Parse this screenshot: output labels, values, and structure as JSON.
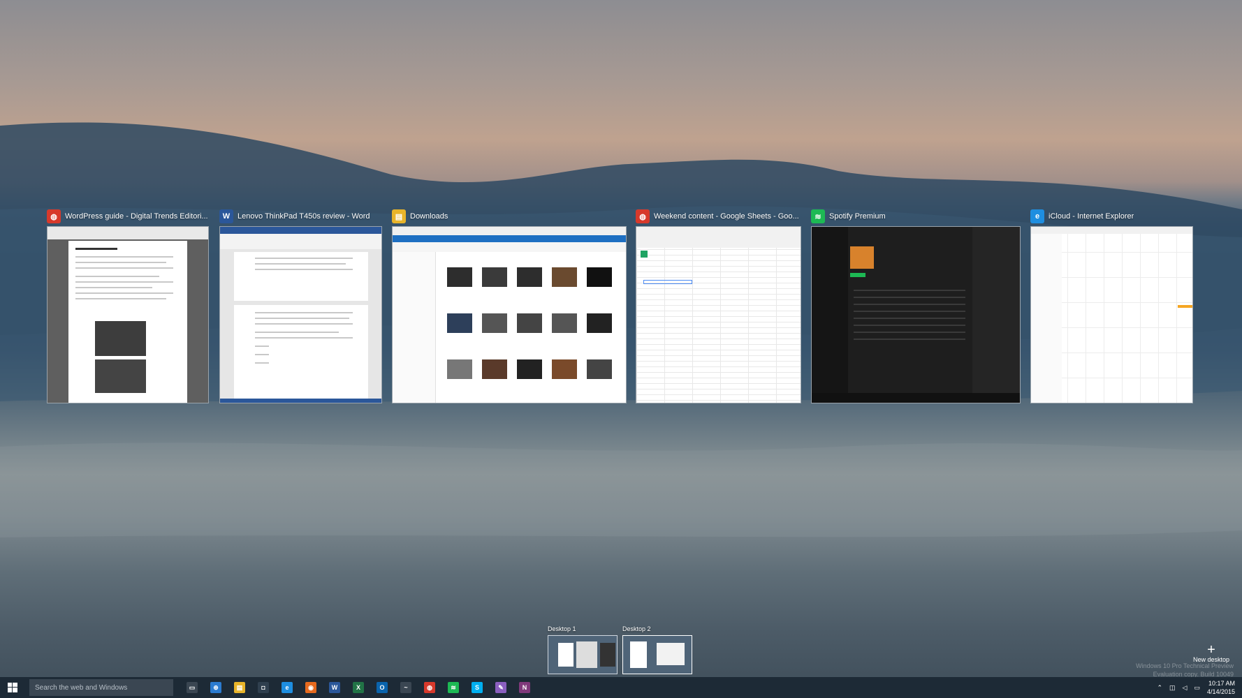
{
  "windows": [
    {
      "title": "WordPress guide - Digital Trends Editori...",
      "icon": "chrome-icon",
      "color": "#d7392b"
    },
    {
      "title": "Lenovo ThinkPad T450s review - Word",
      "icon": "word-icon",
      "color": "#2b579a"
    },
    {
      "title": "Downloads",
      "icon": "file-explorer-icon",
      "color": "#e8b42a"
    },
    {
      "title": "Weekend content - Google Sheets - Goo...",
      "icon": "chrome-icon",
      "color": "#d7392b"
    },
    {
      "title": "Spotify Premium",
      "icon": "spotify-icon",
      "color": "#1db954"
    },
    {
      "title": "iCloud - Internet Explorer",
      "icon": "internet-explorer-icon",
      "color": "#1e8ee0"
    }
  ],
  "desktops": {
    "desktop1_label": "Desktop 1",
    "desktop2_label": "Desktop 2",
    "new_desktop_label": "New desktop"
  },
  "watermark": {
    "line1": "Windows 10 Pro Technical Preview",
    "line2": "Evaluation copy. Build 10049"
  },
  "taskbar": {
    "search_placeholder": "Search the web and Windows",
    "pinned": [
      {
        "name": "task-view-icon",
        "glyph": "▭",
        "color": "#3a4652"
      },
      {
        "name": "store-icon",
        "glyph": "⊕",
        "color": "#2b7bd0"
      },
      {
        "name": "file-explorer-icon",
        "glyph": "▤",
        "color": "#e8b42a"
      },
      {
        "name": "store-bag-icon",
        "glyph": "◘",
        "color": "#2f3f4e"
      },
      {
        "name": "internet-explorer-icon",
        "glyph": "e",
        "color": "#1e8ee0"
      },
      {
        "name": "firefox-icon",
        "glyph": "◉",
        "color": "#e66a1e"
      },
      {
        "name": "word-icon",
        "glyph": "W",
        "color": "#2b579a"
      },
      {
        "name": "excel-icon",
        "glyph": "X",
        "color": "#217346"
      },
      {
        "name": "outlook-icon",
        "glyph": "O",
        "color": "#0a64ad"
      },
      {
        "name": "app-icon",
        "glyph": "~",
        "color": "#3a4652"
      },
      {
        "name": "chrome-icon",
        "glyph": "◍",
        "color": "#d7392b"
      },
      {
        "name": "spotify-icon",
        "glyph": "≋",
        "color": "#1db954"
      },
      {
        "name": "skype-icon",
        "glyph": "S",
        "color": "#00aff0"
      },
      {
        "name": "paint-icon",
        "glyph": "✎",
        "color": "#8b5fbf"
      },
      {
        "name": "onenote-icon",
        "glyph": "N",
        "color": "#80397b"
      }
    ],
    "time": "10:17 AM",
    "date": "4/14/2015"
  }
}
